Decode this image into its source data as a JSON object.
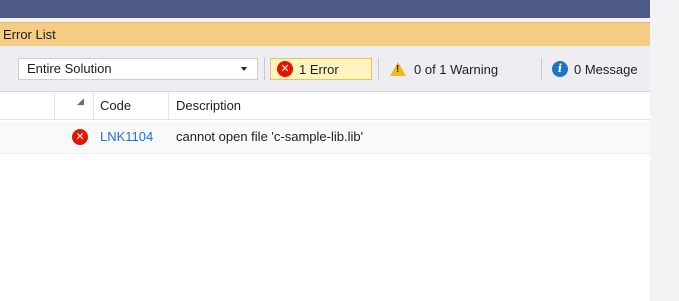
{
  "panel": {
    "title": "Error List"
  },
  "toolbar": {
    "scope_value": "Entire Solution",
    "errors_label": "1 Error",
    "warnings_label": "0 of 1 Warning",
    "messages_label": "0 Message"
  },
  "columns": {
    "code": "Code",
    "description": "Description"
  },
  "rows": [
    {
      "severity": "error",
      "code": "LNK1104",
      "description": "cannot open file 'c-sample-lib.lib'"
    }
  ],
  "icons": {
    "error": "error-x-icon",
    "warning": "warning-triangle-icon",
    "info": "info-icon",
    "dropdown": "chevron-down-icon",
    "sort": "column-sort-icon"
  },
  "colors": {
    "title_bar": "#f5cc84",
    "accent_strip": "#4c5a85",
    "error": "#e51400",
    "info": "#1e74c8",
    "warning": "#f2b718",
    "code_link": "#1e74c8",
    "active_filter_bg": "#fdf4bf"
  }
}
